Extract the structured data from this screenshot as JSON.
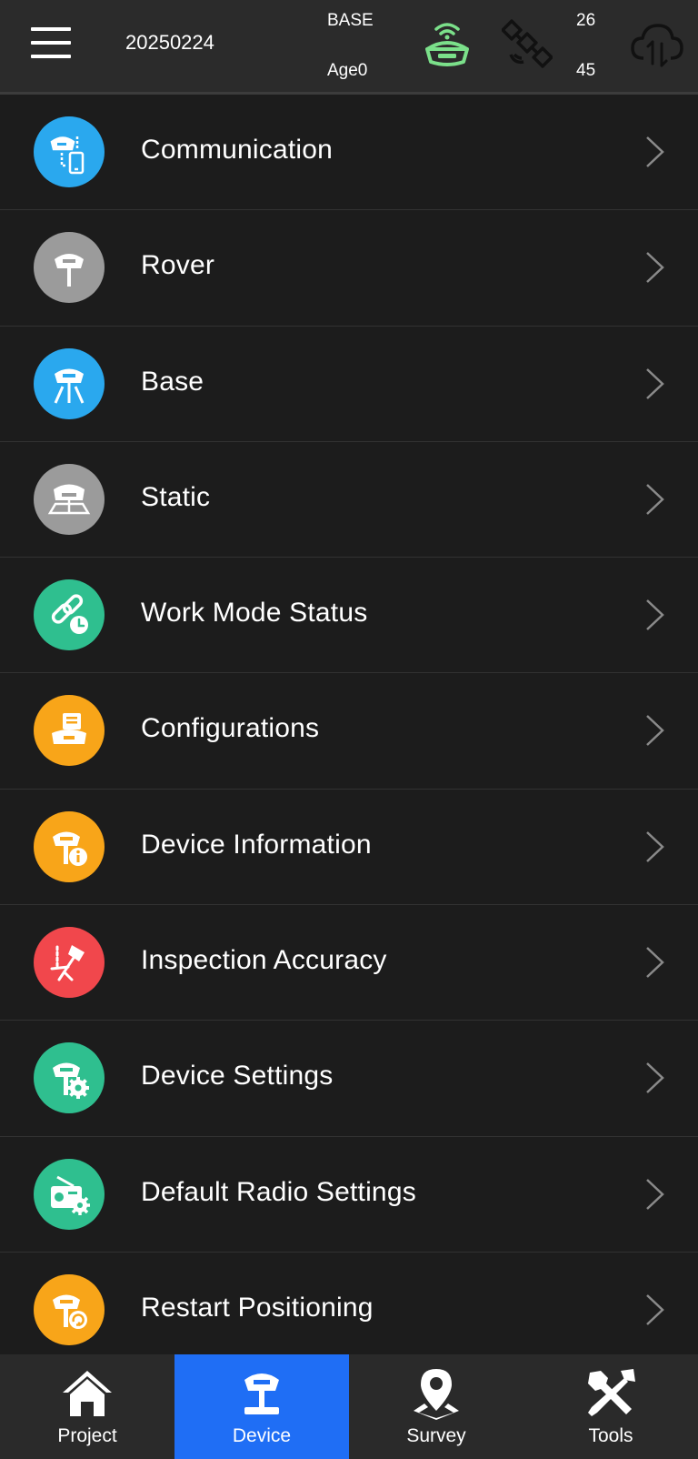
{
  "header": {
    "date": "20250224",
    "mode": "BASE",
    "age": "Age0",
    "sat_top": "26",
    "sat_bottom": "45",
    "icons": [
      "menu-icon",
      "base-station-icon",
      "satellite-icon",
      "cloud-sync-icon"
    ],
    "base_icon_color": "#7be08a"
  },
  "menu": {
    "items": [
      {
        "label": "Communication",
        "icon": "communication-icon",
        "color": "#2aa8ee"
      },
      {
        "label": "Rover",
        "icon": "rover-icon",
        "color": "#9b9b9b"
      },
      {
        "label": "Base",
        "icon": "base-icon",
        "color": "#2aa8ee"
      },
      {
        "label": "Static",
        "icon": "static-icon",
        "color": "#9b9b9b"
      },
      {
        "label": "Work Mode Status",
        "icon": "work-mode-icon",
        "color": "#2fbf8f"
      },
      {
        "label": "Configurations",
        "icon": "configurations-icon",
        "color": "#f8a519"
      },
      {
        "label": "Device Information",
        "icon": "device-info-icon",
        "color": "#f8a519"
      },
      {
        "label": "Inspection Accuracy",
        "icon": "inspection-icon",
        "color": "#f1474c"
      },
      {
        "label": "Device Settings",
        "icon": "device-settings-icon",
        "color": "#2fbf8f"
      },
      {
        "label": "Default Radio Settings",
        "icon": "radio-settings-icon",
        "color": "#2fbf8f"
      },
      {
        "label": "Restart Positioning",
        "icon": "restart-positioning-icon",
        "color": "#f8a519"
      }
    ]
  },
  "nav": {
    "tabs": [
      {
        "label": "Project",
        "icon": "home-icon",
        "active": false
      },
      {
        "label": "Device",
        "icon": "device-icon",
        "active": true
      },
      {
        "label": "Survey",
        "icon": "location-pin-icon",
        "active": false
      },
      {
        "label": "Tools",
        "icon": "tools-icon",
        "active": false
      }
    ],
    "active_color": "#1f6ef5"
  }
}
